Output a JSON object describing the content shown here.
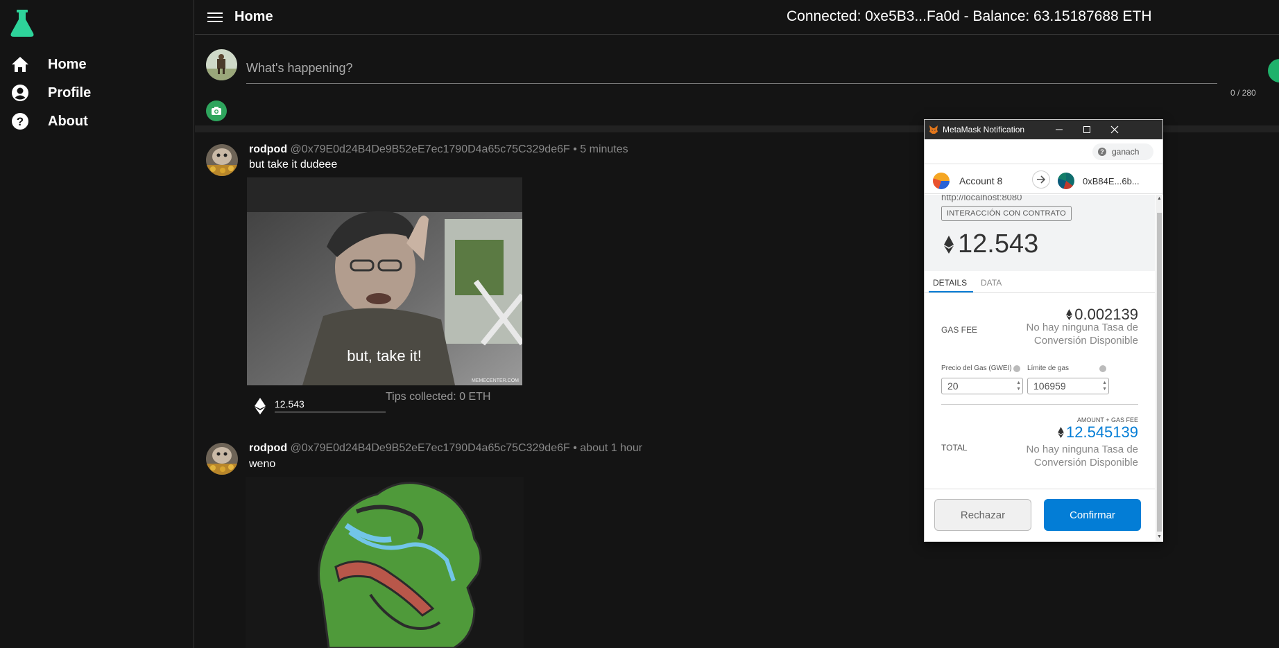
{
  "sidebar": {
    "items": [
      {
        "label": "Home",
        "icon": "home-icon"
      },
      {
        "label": "Profile",
        "icon": "account-circle-icon"
      },
      {
        "label": "About",
        "icon": "help-circle-icon"
      }
    ],
    "accent_color": "#2ed39a"
  },
  "header": {
    "title": "Home",
    "connection": "Connected: 0xe5B3...Fa0d - Balance: 63.15187688 ETH"
  },
  "composer": {
    "placeholder": "What's happening?",
    "char_count": "0 / 280"
  },
  "posts": [
    {
      "author": "rodpod",
      "address": "@0x79E0d24B4De9B52eE7ec1790D4a65c75C329de6F",
      "time": "• 5 minutes",
      "text": "but take it dudeee",
      "image_caption": "but, take it!",
      "image_watermark": "MEMECENTER.COM",
      "tip_value": "12.543",
      "tips_collected": "Tips collected: 0 ETH"
    },
    {
      "author": "rodpod",
      "address": "@0x79E0d24B4De9B52eE7ec1790D4a65c75C329de6F",
      "time": "• about 1 hour",
      "text": "weno"
    }
  ],
  "metamask": {
    "window_title": "MetaMask Notification",
    "network": "ganach",
    "from_account": "Account 8",
    "to_account": "0xB84E...6b...",
    "origin": "http://localhost:8080",
    "badge": "INTERACCIÓN CON CONTRATO",
    "amount": "12.543",
    "tabs": [
      "DETAILS",
      "DATA"
    ],
    "gas_fee_label": "GAS FEE",
    "gas_fee_value": "0.002139",
    "no_conversion": "No hay ninguna Tasa de Conversión Disponible",
    "gas_price_label": "Precio del Gas (GWEI)",
    "gas_price_value": "20",
    "gas_limit_label": "Límite de gas",
    "gas_limit_value": "106959",
    "amount_gas_label": "AMOUNT + GAS FEE",
    "total_label": "TOTAL",
    "total_value": "12.545139",
    "reject_label": "Rechazar",
    "confirm_label": "Confirmar",
    "confirm_color": "#037dd6"
  }
}
